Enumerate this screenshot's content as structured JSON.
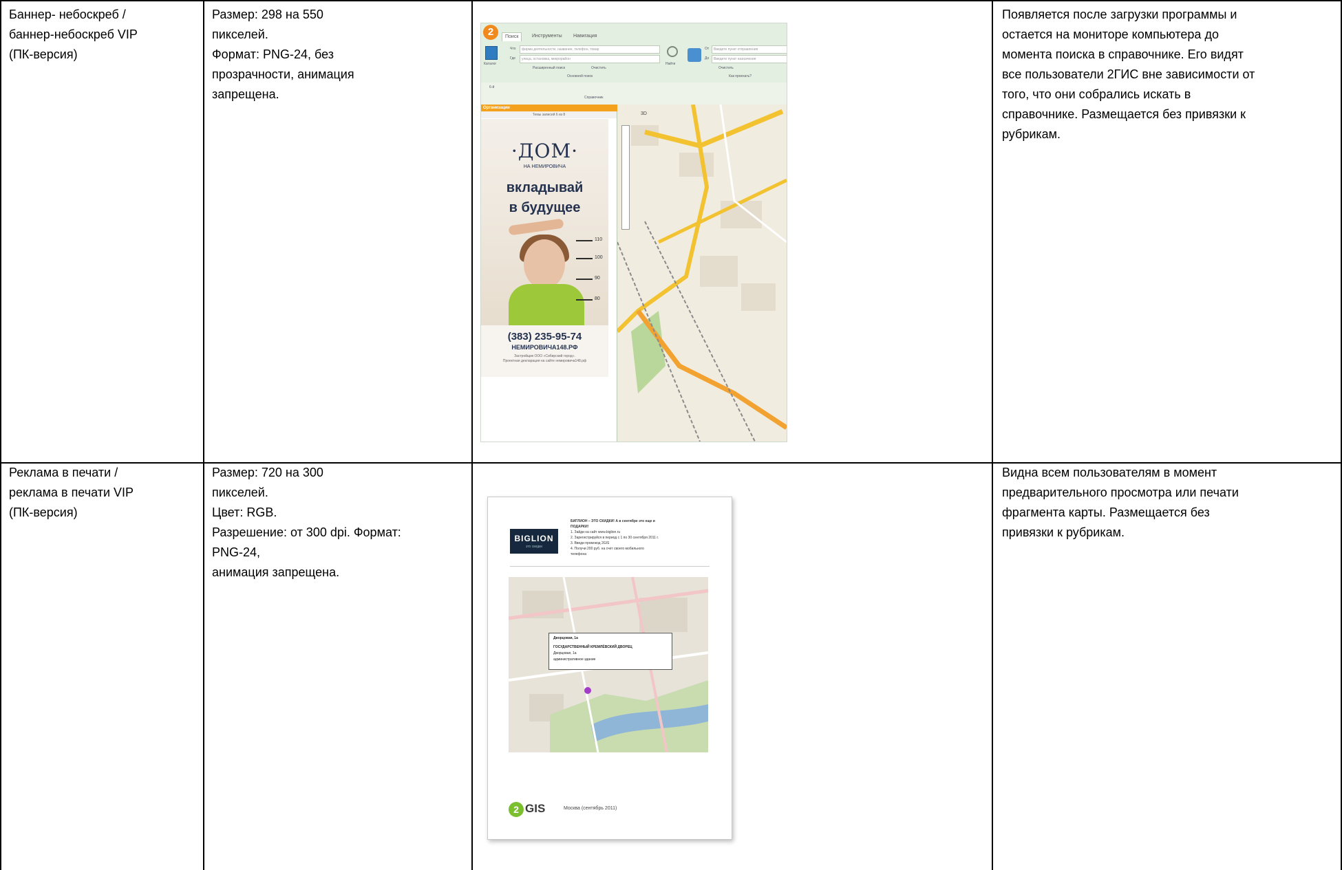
{
  "rows": [
    {
      "name": "Баннер- небоскреб /\nбаннер-небоскреб VIP\n(ПК-версия)",
      "specs": "Размер: 298 на 550\nпикселей.\nФормат: PNG-24, без\nпрозрачности, анимация\nзапрещена.",
      "description": "Появляется после загрузки программы и\nостается на мониторе компьютера до\nмомента поиска в справочнике. Его видят\nвсе пользователи 2ГИС вне зависимости от\nтого, что они собрались искать в\nсправочнике. Размещается без привязки к\nрубрикам."
    },
    {
      "name": "Реклама в печати /\nреклама в печати VIP\n (ПК-версия)",
      "specs": "Размер: 720 на 300\nпикселей.\nЦвет: RGB.\nРазрешение: от 300 dpi. Формат:\nPNG-24,\nанимация запрещена.",
      "description": "Видна всем пользователям в момент\nпредварительного просмотра или печати\nфрагмента карты. Размещается без\nпривязки к рубрикам."
    }
  ],
  "app_screenshot": {
    "logo": "2",
    "tabs": [
      "Поиск",
      "Инструменты",
      "Навигация"
    ],
    "what_label": "Что",
    "what_placeholder": "фирма деятельности, название, телефон, товар",
    "where_label": "Где",
    "where_placeholder": "улица, остановка, микрорайон",
    "catalog_label": "Каталог",
    "find_label": "Найти",
    "advanced_search": "Расширенный поиск",
    "clear": "Очистить",
    "main_search": "Основной поиск",
    "from_label": "От",
    "from_placeholder": "Введите пункт отправления",
    "to_label": "До",
    "to_placeholder": "Введите пункт назначения",
    "route_clear": "Очистить",
    "how_to_get": "Как проехать?",
    "layer": "6-й",
    "directory": "Справочник",
    "organizations": "Организации",
    "shown": "Темы записей 6 из 8",
    "view_3d": "3D",
    "banner": {
      "brand": "·ДОМ·",
      "brand_sub": "НА НЕМИРОВИЧА",
      "slogan_1": "вкладывай",
      "slogan_2": "в будущее",
      "marks": [
        "110",
        "100",
        "90",
        "80"
      ],
      "phone": "(383) 235-95-74",
      "site": "НЕМИРОВИЧА148.РФ",
      "fine_1": "Застройщик ООО «Сибирский город».",
      "fine_2": "Проектная декларация на сайте немировича148.рф"
    }
  },
  "print_preview": {
    "brand": "BIGLION",
    "brand_sub": "это скидки",
    "lines": [
      "БИГЛИОН – ЭТО СКИДКИ! А в сентябре это еще и",
      "ПОДАРКИ!",
      "1. Зайди на сайт www.biglion.ru",
      "2. Зарегистрируйся в период с 1 по 30 сентября 2011 г.",
      "3. Введи промокод 2GIS",
      "4. Получи 200 руб. на счет своего мобильного",
      "телефона"
    ],
    "info_lines": [
      "Дворцовая, 1а",
      "ГОСУДАРСТВЕННЫЙ КРЕМЛЁВСКИЙ ДВОРЕЦ",
      "Дворцовая, 1а",
      "административное здание"
    ],
    "logo": "2",
    "logo_word": "GIS",
    "caption": "Москва (сентябрь 2011)"
  },
  "colors": {
    "accent_orange": "#f4a21e",
    "map_road": "#f2c230",
    "banner_navy": "#24324f",
    "biglion_bg": "#16283e",
    "gis_green": "#7bbf2f"
  }
}
